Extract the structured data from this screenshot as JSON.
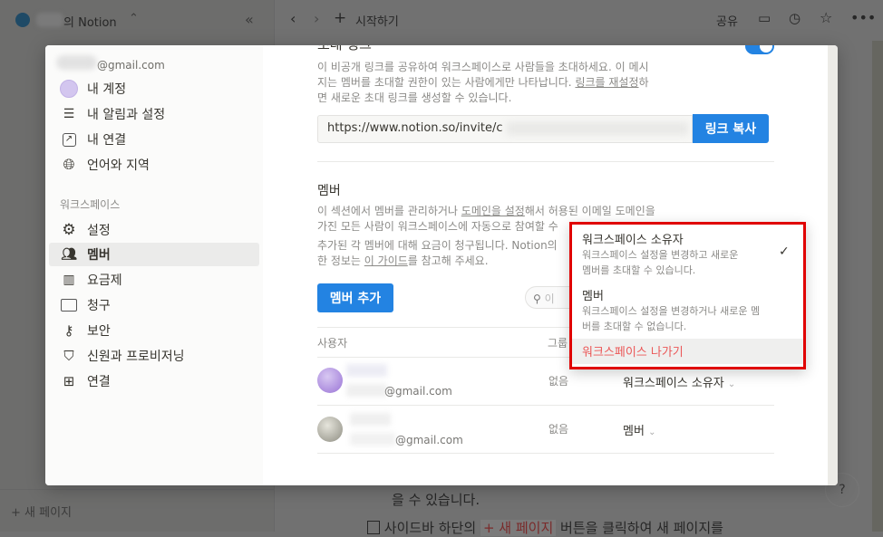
{
  "topbar": {
    "workspace": "의 Notion",
    "breadcrumb": "시작하기",
    "share": "공유"
  },
  "sidebar_bg": {
    "new_page": "새 페이지"
  },
  "page_bg": {
    "line1": "을 수 있습니다.",
    "line2_pre": "사이드바 하단의",
    "line2_chip": "+ 새 페이지",
    "line2_post": "버튼을 클릭하여 새 페이지를",
    "help": "?"
  },
  "settings_nav": {
    "email": "@gmail.com",
    "account": [
      {
        "label": "내 계정",
        "icon": "avatar"
      },
      {
        "label": "내 알림과 설정",
        "icon": "sliders-icon"
      },
      {
        "label": "내 연결",
        "icon": "external-link-icon"
      },
      {
        "label": "언어와 지역",
        "icon": "globe-icon"
      }
    ],
    "workspace_heading": "워크스페이스",
    "workspace": [
      {
        "label": "설정",
        "icon": "gear-icon"
      },
      {
        "label": "멤버",
        "icon": "people-icon",
        "active": true
      },
      {
        "label": "요금제",
        "icon": "map-icon"
      },
      {
        "label": "청구",
        "icon": "credit-card-icon"
      },
      {
        "label": "보안",
        "icon": "key-icon"
      },
      {
        "label": "신원과 프로비저닝",
        "icon": "shield-check-icon"
      },
      {
        "label": "연결",
        "icon": "grid-icon"
      }
    ]
  },
  "invite": {
    "title": "초대 링크",
    "toggle_on": true,
    "desc1": "이 비공개 링크를 공유하여 워크스페이스로 사람들을 초대하세요. 이 메시",
    "desc2": "지는 멤버를 초대할 권한이 있는 사람에게만 나타납니다. ",
    "desc2_link": "링크를 재설정",
    "desc2_end": "하",
    "desc3": "면 새로운 초대 링크를 생성할 수 있습니다.",
    "url": "https://www.notion.so/invite/c",
    "copy_button": "링크 복사"
  },
  "members": {
    "title": "멤버",
    "desc1_pre": "이 섹션에서 멤버를 관리하거나 ",
    "desc1_link": "도메인을 설정",
    "desc1_post": "해서 허용된 이메일 도메인을",
    "desc2": "가진 모든 사람이 워크스페이스에 자동으로 참여할 수",
    "billing1": "추가된 각 멤버에 대해 요금이 청구됩니다. Notion의",
    "billing2_pre": "한 정보는 ",
    "billing2_link": "이 가이드",
    "billing2_post": "를 참고해 주세요.",
    "add_button": "멤버 추가",
    "search_placeholder": "이",
    "columns": [
      "사용자",
      "그룹"
    ],
    "rows": [
      {
        "email": "@gmail.com",
        "group": "없음",
        "role": "워크스페이스 소유자",
        "avatar_color": "#a58bd8"
      },
      {
        "email": "@gmail.com",
        "group": "없음",
        "role": "멤버",
        "avatar_color": "#b4b3a8"
      }
    ]
  },
  "role_menu": {
    "options": [
      {
        "title": "워크스페이스 소유자",
        "desc1": "워크스페이스 설정을 변경하고 새로운",
        "desc2": "멤버를 초대할 수 있습니다.",
        "selected": true
      },
      {
        "title": "멤버",
        "desc1": "워크스페이스 설정을 변경하거나 새로운 멤",
        "desc2": "버를 초대할 수 없습니다.",
        "selected": false
      }
    ],
    "leave": "워크스페이스 나가기",
    "leave_color": "#eb5757",
    "highlight_color": "#e00000"
  },
  "colors": {
    "accent": "#2383e2"
  }
}
